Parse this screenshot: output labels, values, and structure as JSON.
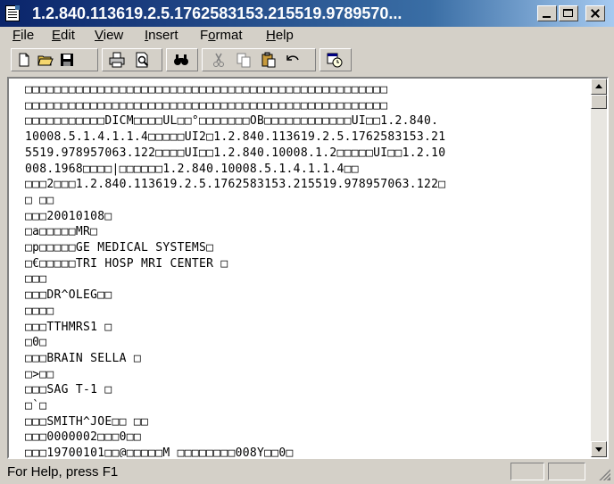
{
  "window": {
    "title": "1.2.840.113619.2.5.1762583153.215519.9789570..."
  },
  "menu": [
    {
      "label": "File",
      "key": "F",
      "rest": "ile"
    },
    {
      "label": "Edit",
      "key": "E",
      "rest": "dit"
    },
    {
      "label": "View",
      "key": "V",
      "rest": "iew"
    },
    {
      "label": "Insert",
      "key": "I",
      "rest": "nsert"
    },
    {
      "label": "Format",
      "key": "o",
      "pre": "F",
      "rest": "rmat"
    },
    {
      "label": "Help",
      "key": "H",
      "rest": "elp"
    }
  ],
  "toolbar": {
    "buttons": [
      "new-icon",
      "open-icon",
      "save-icon",
      "print-icon",
      "print-preview-icon",
      "find-icon",
      "cut-icon",
      "copy-icon",
      "paste-icon",
      "undo-icon",
      "date-time-icon"
    ]
  },
  "document": {
    "lines": [
      "□□□□□□□□□□□□□□□□□□□□□□□□□□□□□□□□□□□□□□□□□□□□□□□□□□",
      "□□□□□□□□□□□□□□□□□□□□□□□□□□□□□□□□□□□□□□□□□□□□□□□□□□",
      "□□□□□□□□□□□DICM□□□□UL□□°□□□□□□□OB□□□□□□□□□□□□UI□□1.2.840.",
      "10008.5.1.4.1.1.4□□□□□UI2□1.2.840.113619.2.5.1762583153.21",
      "5519.978957063.122□□□□UI□□1.2.840.10008.1.2□□□□□UI□□1.2.10",
      "008.1968□□□□|□□□□□□1.2.840.10008.5.1.4.1.1.4□□",
      "□□□2□□□1.2.840.113619.2.5.1762583153.215519.978957063.122□",
      "□ □□",
      "□□□20010108□",
      "□a□□□□□MR□",
      "□p□□□□□GE MEDICAL SYSTEMS□",
      "□€□□□□□TRI HOSP MRI CENTER □",
      "□□□",
      "□□□DR^OLEG□□",
      "□□□□",
      "□□□TTHMRS1 □",
      "□0□",
      "□□□BRAIN SELLA □",
      "□>□□",
      "□□□SAG T-1 □",
      "□`□",
      "□□□SMITH^JOE□□ □□",
      "□□□0000002□□□0□□",
      "□□□19700101□□@□□□□□M □□□□□□□□008Y□□0□"
    ]
  },
  "status": {
    "text": "For Help, press F1"
  }
}
